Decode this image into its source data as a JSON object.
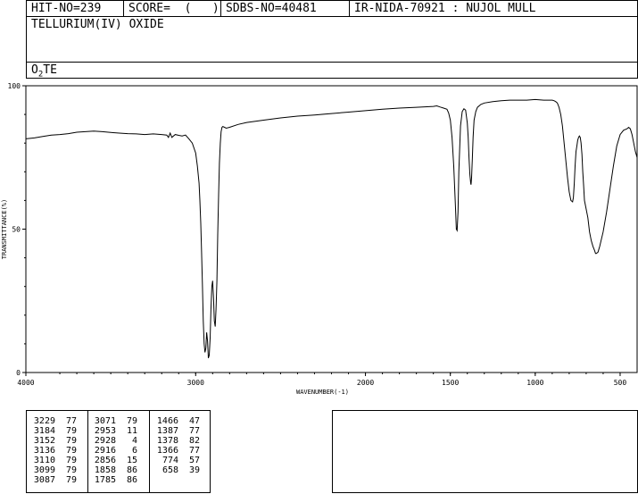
{
  "header": {
    "hit_no": "HIT-NO=239",
    "score": "SCORE=  (   )",
    "sdbs_no": "SDBS-NO=40481",
    "ir_code": "IR-NIDA-70921 : NUJOL MULL",
    "compound_name": "TELLURIUM(IV) OXIDE",
    "formula_prefix": "O",
    "formula_sub": "2",
    "formula_suffix": "TE"
  },
  "chart_data": {
    "type": "line",
    "title": "",
    "xlabel": "WAVENUMBER(-1)",
    "ylabel": "TRANSMITTANCE(%)",
    "xlim": [
      4000,
      400
    ],
    "ylim": [
      0,
      100
    ],
    "x_reversed": true,
    "x_ticks": [
      4000,
      3000,
      2000,
      1500,
      1000,
      500
    ],
    "y_ticks": [
      0,
      50,
      100
    ],
    "series": [
      {
        "x": [
          4000,
          3950,
          3900,
          3850,
          3800,
          3750,
          3700,
          3650,
          3600,
          3550,
          3500,
          3450,
          3400,
          3350,
          3300,
          3250,
          3200,
          3170,
          3160,
          3150,
          3140,
          3120,
          3100,
          3080,
          3060,
          3040,
          3020,
          3000,
          2990,
          2980,
          2975,
          2970,
          2965,
          2960,
          2955,
          2950,
          2945,
          2940,
          2935,
          2930,
          2925,
          2920,
          2915,
          2910,
          2905,
          2900,
          2895,
          2890,
          2885,
          2880,
          2875,
          2870,
          2865,
          2860,
          2855,
          2850,
          2845,
          2840,
          2830,
          2820,
          2800,
          2750,
          2700,
          2600,
          2500,
          2400,
          2300,
          2200,
          2100,
          2000,
          1900,
          1800,
          1700,
          1600,
          1580,
          1560,
          1540,
          1520,
          1510,
          1500,
          1490,
          1480,
          1470,
          1465,
          1460,
          1455,
          1450,
          1440,
          1430,
          1420,
          1410,
          1400,
          1395,
          1390,
          1385,
          1380,
          1378,
          1375,
          1370,
          1366,
          1360,
          1350,
          1340,
          1320,
          1300,
          1250,
          1200,
          1150,
          1100,
          1050,
          1000,
          950,
          920,
          900,
          890,
          880,
          870,
          860,
          850,
          840,
          830,
          820,
          810,
          800,
          790,
          780,
          775,
          770,
          765,
          760,
          755,
          750,
          745,
          740,
          735,
          730,
          725,
          720,
          715,
          710,
          700,
          690,
          680,
          670,
          660,
          650,
          645,
          640,
          630,
          620,
          600,
          580,
          560,
          540,
          520,
          500,
          480,
          460,
          450,
          440,
          430,
          420,
          410,
          400
        ],
        "y": [
          81.5,
          81.8,
          82.3,
          82.8,
          83.0,
          83.3,
          83.8,
          84.0,
          84.2,
          84.0,
          83.7,
          83.5,
          83.3,
          83.2,
          83.0,
          83.2,
          83.0,
          82.8,
          82.0,
          83.5,
          82.0,
          83.0,
          82.7,
          82.5,
          82.8,
          81.5,
          80.0,
          76.5,
          72.0,
          66.0,
          60.0,
          52.0,
          42.0,
          30.0,
          18.0,
          10.0,
          7.0,
          8.5,
          14.0,
          11.0,
          5.0,
          6.0,
          12.0,
          22.0,
          30.0,
          32.0,
          26.0,
          18.0,
          16.0,
          22.0,
          32.0,
          48.0,
          62.0,
          73.0,
          80.0,
          84.0,
          85.5,
          85.8,
          85.5,
          85.2,
          85.5,
          86.5,
          87.2,
          88.0,
          88.8,
          89.4,
          89.8,
          90.3,
          90.8,
          91.3,
          91.8,
          92.2,
          92.5,
          92.8,
          93.0,
          92.6,
          92.2,
          91.8,
          90.5,
          88.0,
          82.0,
          72.0,
          58.0,
          50.0,
          49.5,
          56.0,
          70.0,
          86.0,
          91.0,
          92.0,
          91.5,
          87.0,
          82.0,
          75.0,
          69.0,
          66.0,
          65.5,
          68.0,
          75.0,
          82.0,
          88.0,
          91.0,
          92.5,
          93.5,
          94.0,
          94.5,
          94.8,
          95.0,
          95.0,
          95.0,
          95.2,
          95.0,
          95.0,
          95.0,
          94.8,
          94.5,
          94.0,
          92.5,
          90.0,
          86.0,
          80.0,
          74.0,
          68.0,
          63.0,
          60.0,
          59.5,
          61.0,
          66.0,
          72.0,
          77.0,
          79.0,
          81.0,
          82.0,
          82.5,
          82.0,
          80.0,
          76.0,
          70.0,
          65.0,
          60.0,
          57.0,
          54.0,
          49.0,
          46.0,
          44.0,
          42.5,
          41.5,
          41.5,
          42.0,
          44.0,
          49.0,
          56.0,
          64.0,
          72.0,
          79.0,
          83.0,
          84.5,
          85.0,
          85.5,
          85.0,
          83.0,
          80.0,
          77.0,
          75.0
        ]
      }
    ]
  },
  "peak_table": {
    "columns": [
      [
        [
          "3229",
          "77"
        ],
        [
          "3184",
          "79"
        ],
        [
          "3152",
          "79"
        ],
        [
          "3136",
          "79"
        ],
        [
          "3110",
          "79"
        ],
        [
          "3099",
          "79"
        ],
        [
          "3087",
          "79"
        ]
      ],
      [
        [
          "3071",
          "79"
        ],
        [
          "2953",
          "11"
        ],
        [
          "2928",
          "4"
        ],
        [
          "2916",
          "6"
        ],
        [
          "2856",
          "15"
        ],
        [
          "1858",
          "86"
        ],
        [
          "1785",
          "86"
        ]
      ],
      [
        [
          "1466",
          "47"
        ],
        [
          "1387",
          "77"
        ],
        [
          "1378",
          "82"
        ],
        [
          "1366",
          "77"
        ],
        [
          "774",
          "57"
        ],
        [
          "658",
          "39"
        ]
      ]
    ]
  }
}
